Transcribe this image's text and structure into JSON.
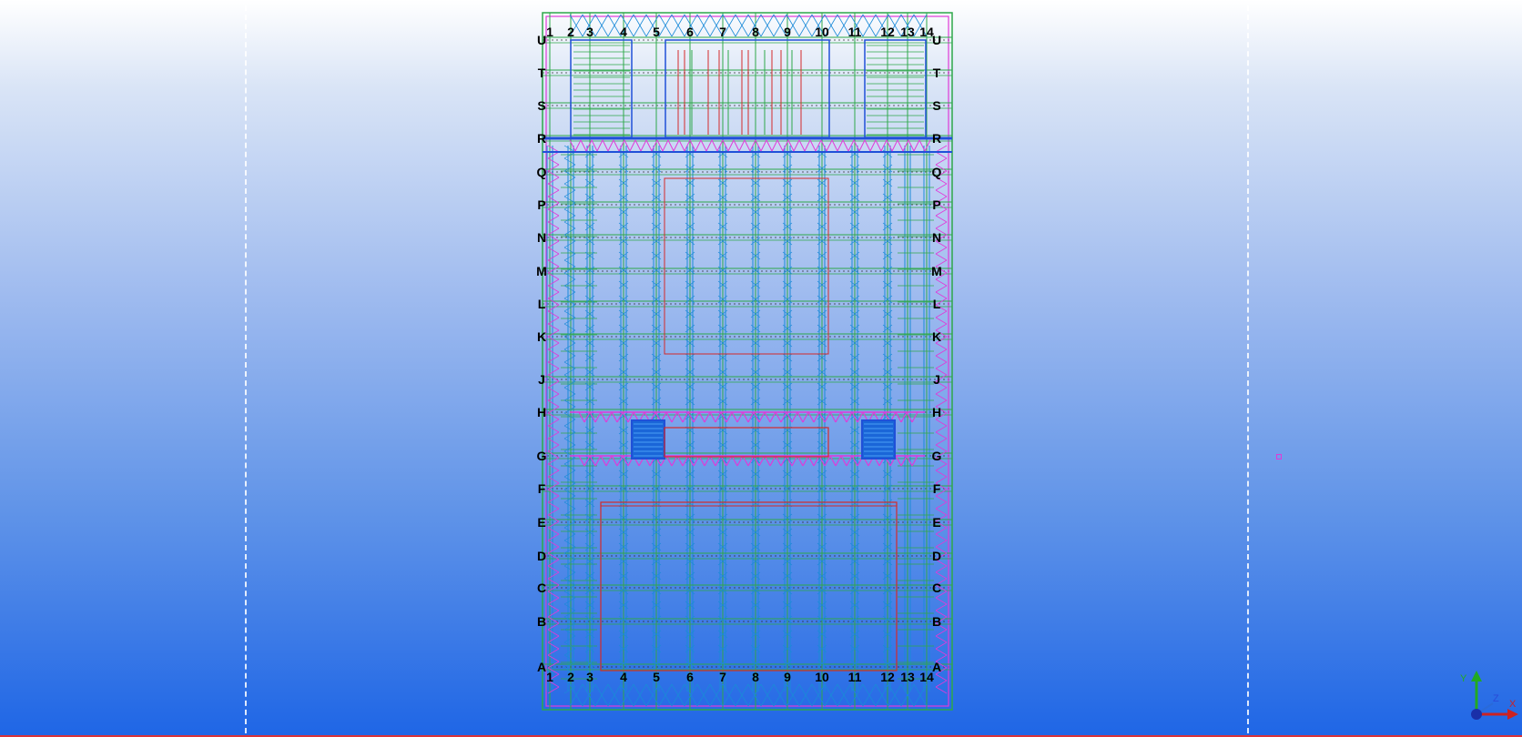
{
  "viewport": {
    "background_top": "#ffffff",
    "background_bottom": "#1f66e6",
    "border_color": "#d8333a"
  },
  "model": {
    "column_labels": [
      "1",
      "2",
      "3",
      "4",
      "5",
      "6",
      "7",
      "8",
      "9",
      "10",
      "11",
      "12",
      "13",
      "14"
    ],
    "row_labels": [
      "U",
      "T",
      "S",
      "R",
      "Q",
      "P",
      "N",
      "M",
      "L",
      "K",
      "J",
      "H",
      "G",
      "F",
      "E",
      "D",
      "C",
      "B",
      "A"
    ],
    "colors": {
      "bracing": "#e03ad8",
      "beams": "#2ea84a",
      "columns": "#1a8ad8",
      "walls": "#2050d8",
      "frames": "#d42a2a",
      "gridlines": "#333333"
    }
  },
  "axis_triad": {
    "x_color": "#cc2222",
    "y_color": "#22aa22",
    "z_color": "#2222cc",
    "x_label": "X",
    "y_label": "Y",
    "z_label": "Z"
  }
}
